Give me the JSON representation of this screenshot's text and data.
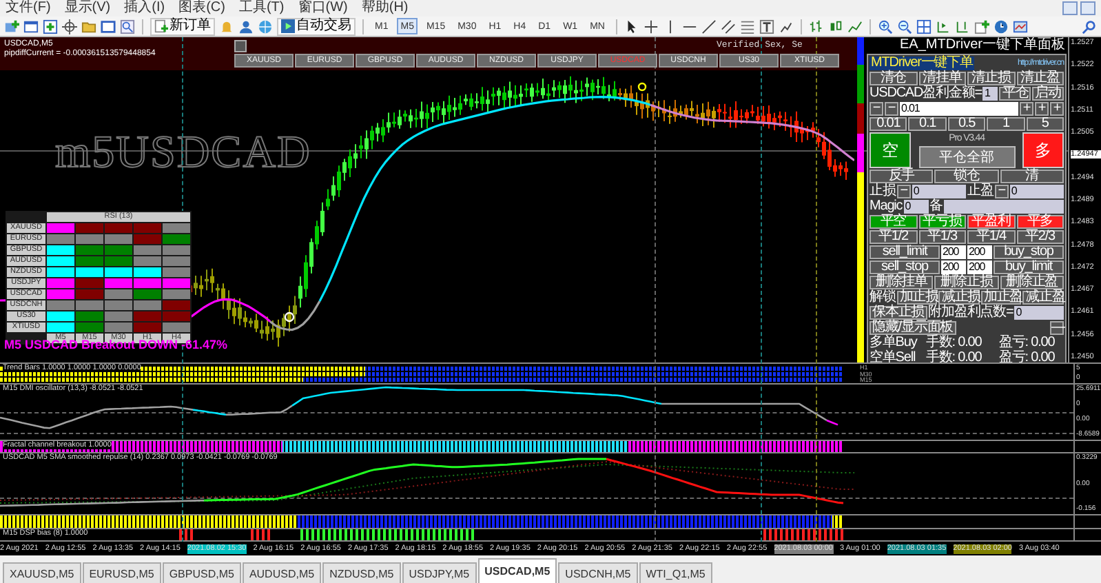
{
  "menu_bar": {
    "items": [
      "文件(F)",
      "显示(V)",
      "插入(I)",
      "图表(C)",
      "工具(T)",
      "窗口(W)",
      "帮助(H)"
    ]
  },
  "toolbar": {
    "new_order": "新订单",
    "auto_trading": "自动交易",
    "timeframes": [
      {
        "label": "M1",
        "selected": false
      },
      {
        "label": "M5",
        "selected": true
      },
      {
        "label": "M15",
        "selected": false
      },
      {
        "label": "M30",
        "selected": false
      },
      {
        "label": "H1",
        "selected": false
      },
      {
        "label": "H4",
        "selected": false
      },
      {
        "label": "D1",
        "selected": false
      },
      {
        "label": "W1",
        "selected": false
      },
      {
        "label": "MN",
        "selected": false
      }
    ]
  },
  "chart": {
    "title": "USDCAD,M5",
    "info": "pipdiffCurrent = -0.000361513579448854",
    "symbol_label": "m5USDCAD",
    "pair_buttons": [
      {
        "label": "XAUUSD",
        "selected": false
      },
      {
        "label": "EURUSD",
        "selected": false
      },
      {
        "label": "GBPUSD",
        "selected": false
      },
      {
        "label": "AUDUSD",
        "selected": false
      },
      {
        "label": "NZDUSD",
        "selected": false
      },
      {
        "label": "USDJPY",
        "selected": false
      },
      {
        "label": "USDCAD",
        "selected": true
      },
      {
        "label": "USDCNH",
        "selected": false
      },
      {
        "label": "US30",
        "selected": false
      },
      {
        "label": "XTIUSD",
        "selected": false
      }
    ],
    "ea_title": "EA_MTDriver一键下单面板",
    "verified": "Verified Sex, Se",
    "breakout_text": "M5 USDCAD Breakout DOWN -61.47%",
    "rsi_table": {
      "title": "RSI (13)",
      "columns": [
        "M5",
        "M15",
        "M30",
        "H1",
        "H4"
      ],
      "rows": [
        {
          "symbol": "XAUUSD",
          "cells": [
            {
              "color": "#ff00ff"
            },
            {
              "color": "#800000"
            },
            {
              "color": "#800000"
            },
            {
              "color": "#800000"
            },
            {
              "color": "#808080"
            }
          ]
        },
        {
          "symbol": "EURUSD",
          "cells": [
            {
              "color": "#808080"
            },
            {
              "color": "#808080"
            },
            {
              "color": "#808080"
            },
            {
              "color": "#800000"
            },
            {
              "color": "#008000"
            }
          ]
        },
        {
          "symbol": "GBPUSD",
          "cells": [
            {
              "color": "#00ffff"
            },
            {
              "color": "#008000"
            },
            {
              "color": "#008000"
            },
            {
              "color": "#808080"
            },
            {
              "color": "#808080"
            }
          ]
        },
        {
          "symbol": "AUDUSD",
          "cells": [
            {
              "color": "#00ffff"
            },
            {
              "color": "#008000"
            },
            {
              "color": "#008000"
            },
            {
              "color": "#808080"
            },
            {
              "color": "#808080"
            }
          ]
        },
        {
          "symbol": "NZDUSD",
          "cells": [
            {
              "color": "#00ffff"
            },
            {
              "color": "#00ffff"
            },
            {
              "color": "#00ffff"
            },
            {
              "color": "#00ffff"
            },
            {
              "color": "#808080"
            }
          ]
        },
        {
          "symbol": "USDJPY",
          "cells": [
            {
              "color": "#ff00ff"
            },
            {
              "color": "#800000"
            },
            {
              "color": "#ff00ff"
            },
            {
              "color": "#ff00ff"
            },
            {
              "color": "#ff00ff"
            }
          ]
        },
        {
          "symbol": "USDCAD",
          "cells": [
            {
              "color": "#ff00ff"
            },
            {
              "color": "#800000"
            },
            {
              "color": "#808080"
            },
            {
              "color": "#008000"
            },
            {
              "color": "#808080"
            }
          ]
        },
        {
          "symbol": "USDCNH",
          "cells": [
            {
              "color": "#808080"
            },
            {
              "color": "#808080"
            },
            {
              "color": "#808080"
            },
            {
              "color": "#808080"
            },
            {
              "color": "#800000"
            }
          ]
        },
        {
          "symbol": "US30",
          "cells": [
            {
              "color": "#00ffff"
            },
            {
              "color": "#008000"
            },
            {
              "color": "#808080"
            },
            {
              "color": "#800000"
            },
            {
              "color": "#800000"
            }
          ]
        },
        {
          "symbol": "XTIUSD",
          "cells": [
            {
              "color": "#00ffff"
            },
            {
              "color": "#008000"
            },
            {
              "color": "#808080"
            },
            {
              "color": "#800000"
            },
            {
              "color": "#808080"
            }
          ]
        }
      ]
    },
    "price_ticks": [
      {
        "label": "1.2527",
        "current": false
      },
      {
        "label": "1.2522",
        "current": false
      },
      {
        "label": "1.2516",
        "current": false
      },
      {
        "label": "1.2511",
        "current": false
      },
      {
        "label": "1.2505",
        "current": false
      },
      {
        "label": "1.24947",
        "current": true
      },
      {
        "label": "1.2494",
        "current": false
      },
      {
        "label": "1.2489",
        "current": false
      },
      {
        "label": "1.2483",
        "current": false
      },
      {
        "label": "1.2478",
        "current": false
      },
      {
        "label": "1.2472",
        "current": false
      },
      {
        "label": "1.2467",
        "current": false
      },
      {
        "label": "1.2461",
        "current": false
      },
      {
        "label": "1.2456",
        "current": false
      },
      {
        "label": "1.2450",
        "current": false
      }
    ]
  },
  "panel": {
    "title": "MTDriver一键下单",
    "link": "http://mtdriver.cn",
    "action_buttons": [
      "清仓",
      "清挂单",
      "清止损",
      "清止盈"
    ],
    "profit_label": "USDCAD盈利金额=",
    "profit_value": "1",
    "close_button": "平仓",
    "start_button": "启动",
    "lot_minus": [
      "−",
      "−"
    ],
    "lot_value": "0.01",
    "lot_plus": [
      "+",
      "+",
      "+"
    ],
    "lot_presets": [
      "0.01",
      "0.1",
      "0.5",
      "1",
      "5"
    ],
    "sell_button": "空",
    "buy_button": "多",
    "version": "Pro V3.44",
    "close_all": "平仓全部",
    "ops": [
      "反手",
      "锁仓",
      "清"
    ],
    "stop_loss": {
      "label": "止损",
      "minus": "−",
      "value": "0"
    },
    "take_profit": {
      "label": "止盈",
      "minus": "−",
      "value": "0"
    },
    "magic_label": "Magic",
    "magic_value": "0",
    "note_label": "备",
    "close_buttons": [
      {
        "label": "平空",
        "color": "#00a000"
      },
      {
        "label": "平亏损",
        "color": "#00a000"
      },
      {
        "label": "平盈利",
        "color": "#ff2020"
      },
      {
        "label": "平多",
        "color": "#ff2020"
      }
    ],
    "partial": [
      "平1/2",
      "平1/3",
      "平1/4",
      "平2/3"
    ],
    "pending": [
      {
        "left": "sell_limit",
        "v1": "200",
        "v2": "200",
        "right": "buy_stop"
      },
      {
        "left": "sell_stop",
        "v1": "200",
        "v2": "200",
        "right": "buy_limit"
      }
    ],
    "delete_buttons": [
      "删除挂单",
      "删除止损",
      "删除止盈"
    ],
    "lock_label": "解锁",
    "lock_buttons": [
      "加止损",
      "减止损",
      "加止盈",
      "减止盈"
    ],
    "breakeven": "保本止损",
    "extra_label": "附加盈利点数=",
    "extra_value": "0",
    "toggle": "隐藏/显示面板",
    "minimize": "—",
    "summary": [
      {
        "side": "多单Buy",
        "lots": "手数: 0.00",
        "pnl": "盈亏: 0.00"
      },
      {
        "side": "空单Sell",
        "lots": "手数: 0.00",
        "pnl": "盈亏: 0.00"
      }
    ]
  },
  "indicators": [
    {
      "kind": "dots",
      "label": "Trend Bars 1.0000 1.0000 1.0000 0.0000",
      "row_labels": [
        "H1",
        "M30",
        "M15"
      ],
      "axis": [
        "5",
        "0"
      ]
    },
    {
      "kind": "oscillator",
      "label": "M15 DMI oscillator (13,3) -8.0521 -8.0521",
      "axis": [
        "25.6911",
        "0",
        "0.00",
        "-8.6589"
      ]
    },
    {
      "kind": "strip",
      "label": "Fractal channel breakout 1.0000"
    },
    {
      "kind": "repulse",
      "label": "USDCAD M5 SMA smoothed repulse (14) 0.2367 0.0973 -0.0421 -0.0769 -0.0769",
      "axis": [
        "0.3229",
        "0.00",
        "-0.156"
      ]
    },
    {
      "kind": "strip2"
    },
    {
      "kind": "ticks",
      "label": "M15 DSP bias (8) 1.0000"
    }
  ],
  "time_axis": [
    {
      "label": "2 Aug 2021"
    },
    {
      "label": "2 Aug 12:55"
    },
    {
      "label": "2 Aug 13:35"
    },
    {
      "label": "2 Aug 14:15"
    },
    {
      "label": "2021.08.02 15:30",
      "color": "#00c0c0"
    },
    {
      "label": "2 Aug 16:15"
    },
    {
      "label": "2 Aug 16:55"
    },
    {
      "label": "2 Aug 17:35"
    },
    {
      "label": "2 Aug 18:15"
    },
    {
      "label": "2 Aug 18:55"
    },
    {
      "label": "2 Aug 19:35"
    },
    {
      "label": "2 Aug 20:15"
    },
    {
      "label": "2 Aug 20:55"
    },
    {
      "label": "2 Aug 21:35"
    },
    {
      "label": "2 Aug 22:15"
    },
    {
      "label": "2 Aug 22:55"
    },
    {
      "label": "2021.08.03 00:00",
      "color": "#808080"
    },
    {
      "label": "3 Aug 01:00"
    },
    {
      "label": "2021.08.03 01:35",
      "color": "#008080"
    },
    {
      "label": "2021.08.03 02:00",
      "color": "#808000"
    },
    {
      "label": "3 Aug 03:40"
    }
  ],
  "tabs": [
    {
      "label": "XAUUSD,M5",
      "selected": false
    },
    {
      "label": "EURUSD,M5",
      "selected": false
    },
    {
      "label": "GBPUSD,M5",
      "selected": false
    },
    {
      "label": "AUDUSD,M5",
      "selected": false
    },
    {
      "label": "NZDUSD,M5",
      "selected": false
    },
    {
      "label": "USDJPY,M5",
      "selected": false
    },
    {
      "label": "USDCAD,M5",
      "selected": true
    },
    {
      "label": "USDCNH,M5",
      "selected": false
    },
    {
      "label": "WTI_Q1,M5",
      "selected": false
    }
  ]
}
